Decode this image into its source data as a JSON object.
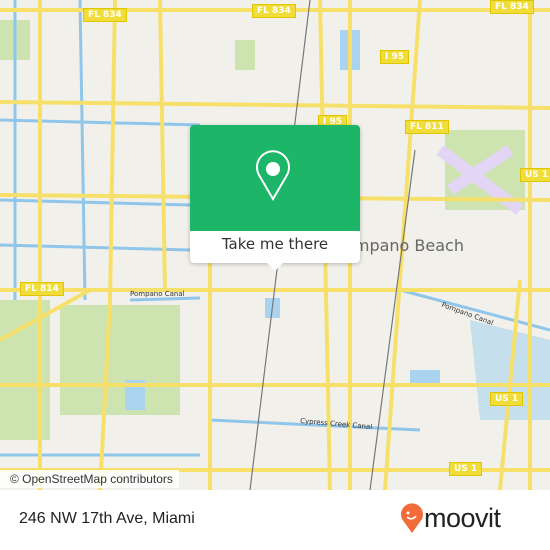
{
  "map": {
    "shields": [
      "FL 834",
      "FL 834",
      "FL 834",
      "I 95",
      "I 95",
      "FL 811",
      "US 1",
      "US 1",
      "US 1",
      "FL 814"
    ],
    "canals": [
      "Pompano Canal",
      "Pompano Canal",
      "Cypress Creek Canal"
    ],
    "city": "Pompano Beach",
    "attribution": "© OpenStreetMap contributors",
    "colors": {
      "land": "#f2f0ea",
      "road": "#f6e06a",
      "water": "#a9d3ee",
      "park": "#cde3b0",
      "accent": "#1db668"
    }
  },
  "popup": {
    "icon": "map-pin-icon",
    "action": "Take me there"
  },
  "footer": {
    "address": "246 NW 17th Ave, Miami",
    "brand": "moovit",
    "brand_color": "#f26b3a"
  }
}
